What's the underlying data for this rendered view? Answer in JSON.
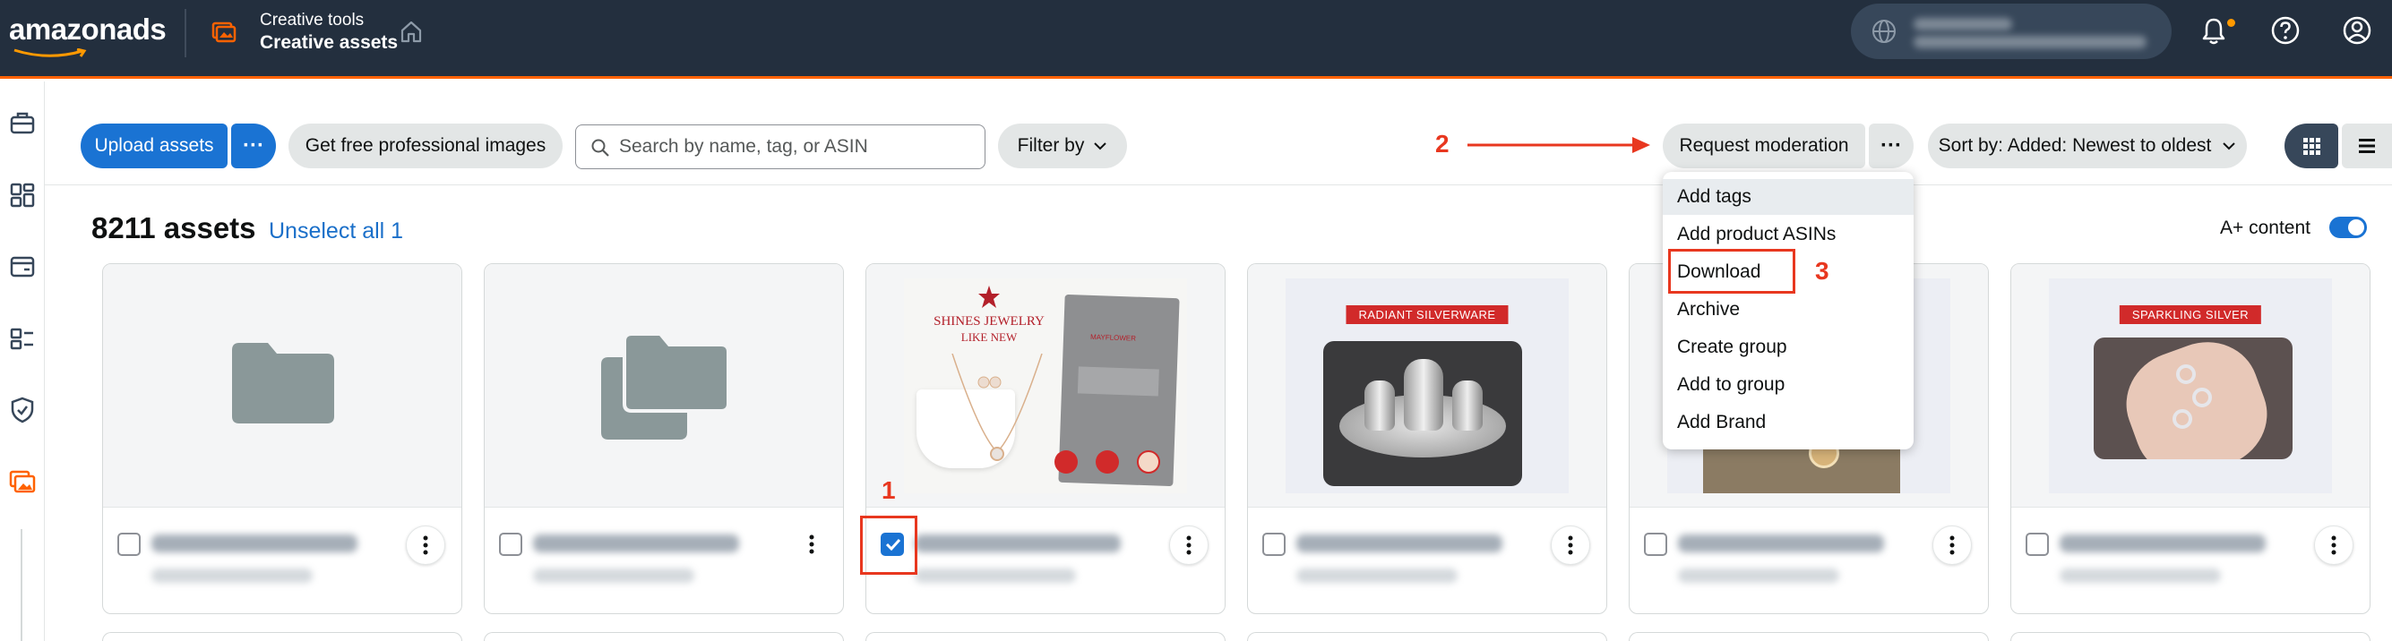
{
  "header": {
    "logo_text": "amazonads",
    "breadcrumb_parent": "Creative tools",
    "breadcrumb_current": "Creative assets",
    "accent_color": "#ff6200",
    "icons": [
      "app-switcher-icon",
      "home-icon",
      "globe-icon",
      "bell-icon",
      "help-icon",
      "user-icon"
    ]
  },
  "sidebar": {
    "icons": [
      "campaigns-icon",
      "dashboard-icon",
      "wallet-icon",
      "products-icon",
      "brand-safety-icon",
      "creative-assets-icon"
    ]
  },
  "toolbar": {
    "upload_label": "Upload assets",
    "upload_more": "···",
    "pro_images_label": "Get free professional images",
    "search_placeholder": "Search by name, tag, or ASIN",
    "filter_label": "Filter by",
    "moderation_label": "Request moderation",
    "moderation_more": "···",
    "sort_label": "Sort by: Added: Newest to oldest"
  },
  "summary": {
    "count": "8211 assets",
    "unselect": "Unselect all 1",
    "aplus_label": "A+ content",
    "aplus_enabled": true
  },
  "menu": {
    "items": [
      "Add tags",
      "Add product ASINs",
      "Download",
      "Archive",
      "Create group",
      "Add to group",
      "Add Brand"
    ]
  },
  "annotations": {
    "step1": "1",
    "step2": "2",
    "step3": "3"
  },
  "cards": [
    {
      "type": "folder",
      "checked": false
    },
    {
      "type": "group",
      "checked": false
    },
    {
      "type": "image",
      "title_top": "SHINES JEWELRY",
      "title_sub": "LIKE NEW",
      "brand": "MAYFLOWER",
      "checked": true
    },
    {
      "type": "image",
      "ribbon": "RADIANT SILVERWARE",
      "checked": false
    },
    {
      "type": "image",
      "checked": false
    },
    {
      "type": "image",
      "ribbon": "SPARKLING SILVER",
      "checked": false
    }
  ]
}
